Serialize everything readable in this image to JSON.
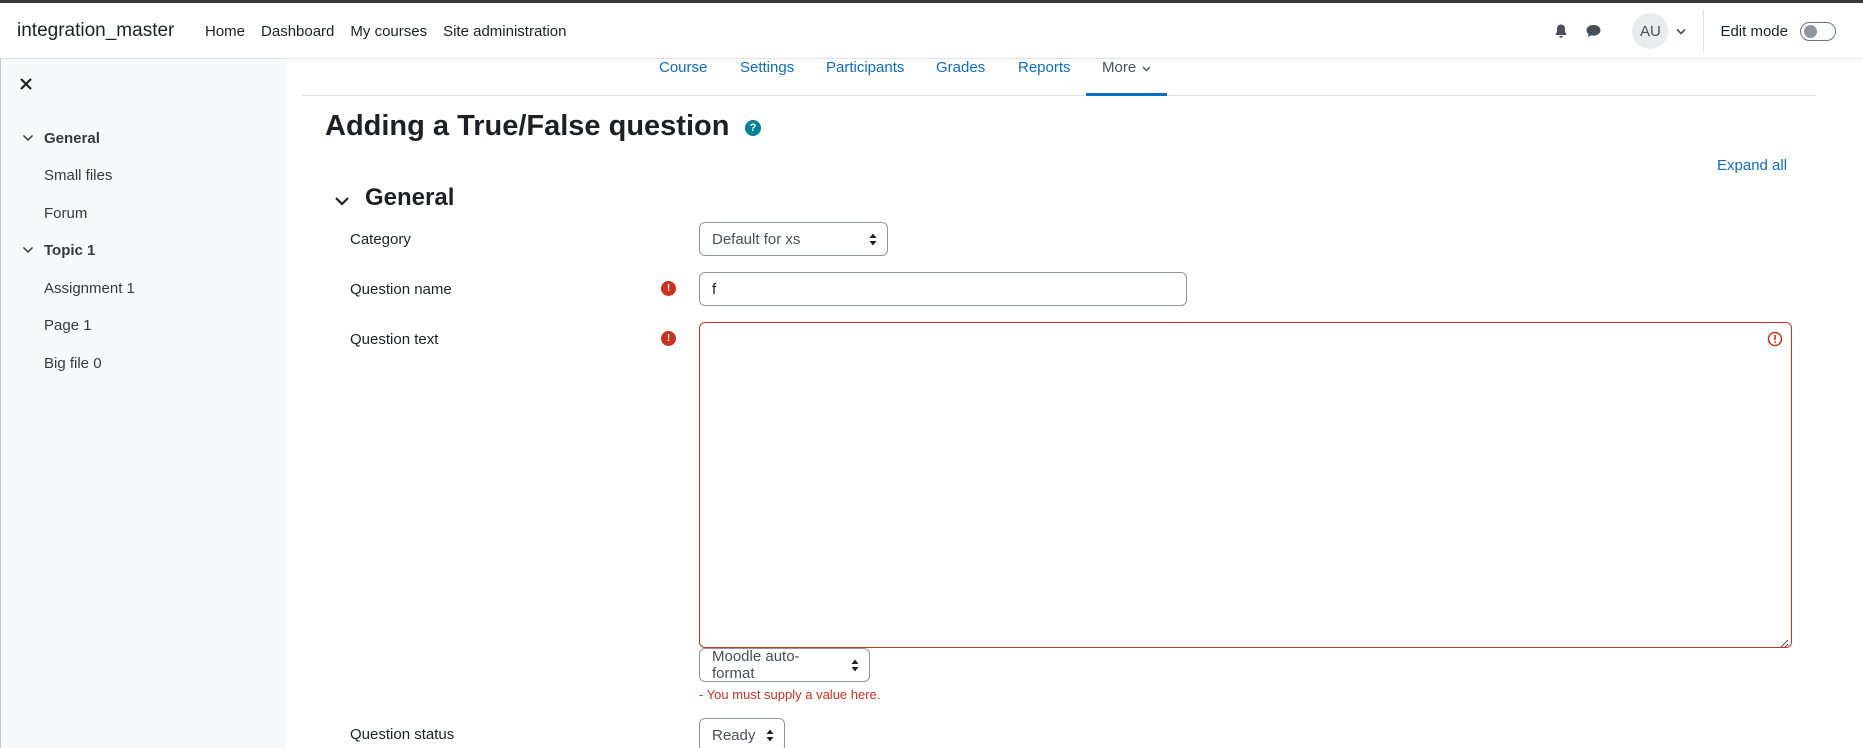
{
  "navbar": {
    "brand": "integration_master",
    "items": [
      "Home",
      "Dashboard",
      "My courses",
      "Site administration"
    ],
    "avatar_initials": "AU",
    "edit_mode_label": "Edit mode"
  },
  "drawer": {
    "sections": [
      {
        "title": "General",
        "items": [
          "Small files",
          "Forum"
        ]
      },
      {
        "title": "Topic 1",
        "items": [
          "Assignment 1",
          "Page 1",
          "Big file 0"
        ]
      }
    ]
  },
  "secondary_nav": {
    "tabs": [
      "Course",
      "Settings",
      "Participants",
      "Grades",
      "Reports"
    ],
    "more": "More"
  },
  "page": {
    "title": "Adding a True/False question",
    "help_glyph": "?",
    "expand_all": "Expand all",
    "section_title": "General"
  },
  "form": {
    "category_label": "Category",
    "category_value": "Default for xs",
    "question_name_label": "Question name",
    "question_name_value": "f",
    "question_text_label": "Question text",
    "format_value": "Moodle auto-format",
    "error_text": "- You must supply a value here.",
    "status_label": "Question status",
    "status_value": "Ready",
    "required_glyph": "!"
  },
  "colors": {
    "link": "#0f6cbf",
    "error": "#ca3120",
    "help": "#008196"
  }
}
